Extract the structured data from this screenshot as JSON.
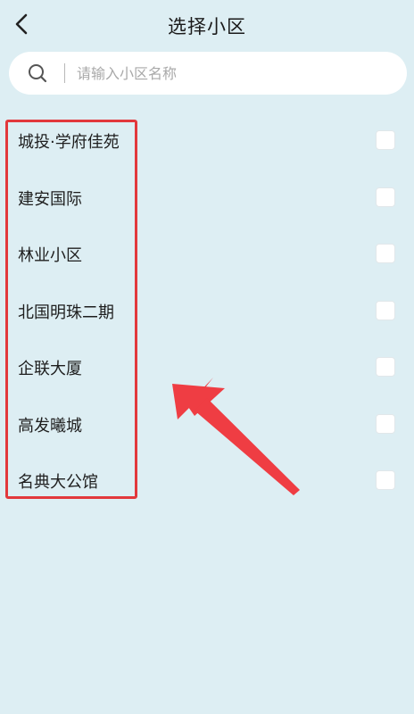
{
  "header": {
    "title": "选择小区",
    "back_icon": "chevron-left-icon"
  },
  "search": {
    "placeholder": "请输入小区名称",
    "value": "",
    "icon": "search-icon"
  },
  "communities": [
    {
      "label": "城投·学府佳苑",
      "checked": false
    },
    {
      "label": "建安国际",
      "checked": false
    },
    {
      "label": "林业小区",
      "checked": false
    },
    {
      "label": "北国明珠二期",
      "checked": false
    },
    {
      "label": "企联大厦",
      "checked": false
    },
    {
      "label": "高发曦城",
      "checked": false
    },
    {
      "label": "名典大公馆",
      "checked": false
    }
  ],
  "colors": {
    "background": "#ddeef3",
    "highlight": "#e2383c",
    "arrow": "#ef3d43"
  }
}
